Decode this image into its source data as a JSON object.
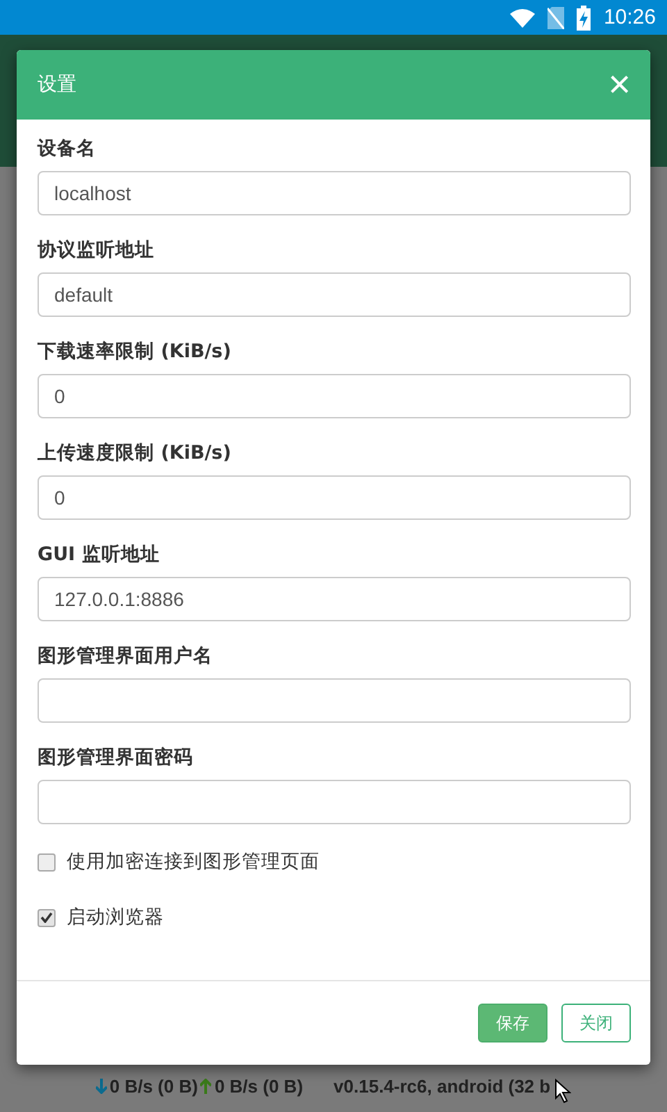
{
  "status_bar": {
    "time": "10:26"
  },
  "dialog": {
    "title": "设置",
    "close": "×",
    "fields": [
      {
        "label": "设备名",
        "value": "localhost"
      },
      {
        "label": "协议监听地址",
        "value": "default"
      },
      {
        "label": "下载速率限制 (KiB/s)",
        "value": "0"
      },
      {
        "label": "上传速度限制 (KiB/s)",
        "value": "0"
      },
      {
        "label": "GUI 监听地址",
        "value": "127.0.0.1:8886"
      },
      {
        "label": "图形管理界面用户名"
      },
      {
        "label": "图形管理界面密码"
      }
    ],
    "checkboxes": [
      {
        "label": "使用加密连接到图形管理页面",
        "checked": false
      },
      {
        "label": "启动浏览器",
        "checked": true
      }
    ],
    "buttons": [
      {
        "label": "保存",
        "kind": "primary"
      },
      {
        "label": "关闭",
        "kind": "secondary"
      }
    ]
  },
  "footer": {
    "download": "0 B/s (0 B)",
    "upload": "0 B/s (0 B)",
    "version": "v0.15.4-rc6, android (32 b"
  }
}
